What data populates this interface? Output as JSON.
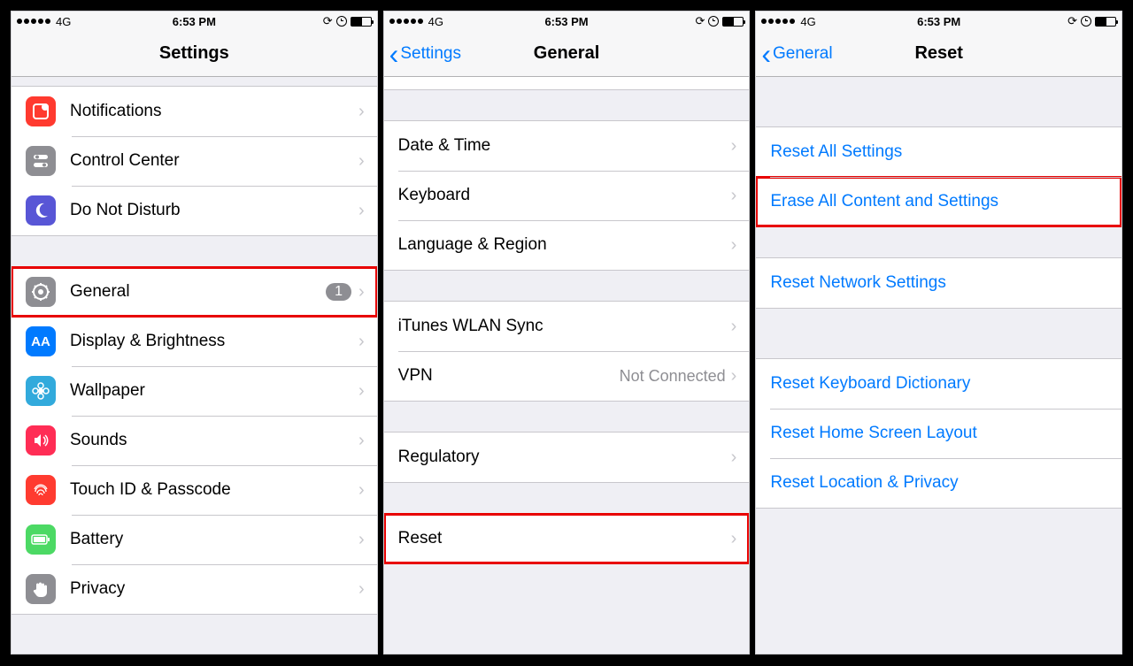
{
  "status": {
    "network": "4G",
    "time": "6:53 PM"
  },
  "screen1": {
    "title": "Settings",
    "rows": [
      {
        "label": "Notifications",
        "icon": "notification-icon",
        "color": "ic-orange"
      },
      {
        "label": "Control Center",
        "icon": "toggles-icon",
        "color": "ic-grey"
      },
      {
        "label": "Do Not Disturb",
        "icon": "moon-icon",
        "color": "ic-purple"
      },
      {
        "label": "General",
        "icon": "gear-icon",
        "color": "ic-grey",
        "badge": "1",
        "highlight": true
      },
      {
        "label": "Display & Brightness",
        "icon": "aa-icon",
        "color": "ic-blue"
      },
      {
        "label": "Wallpaper",
        "icon": "flower-icon",
        "color": "ic-cyan"
      },
      {
        "label": "Sounds",
        "icon": "speaker-icon",
        "color": "ic-pink"
      },
      {
        "label": "Touch ID & Passcode",
        "icon": "fingerprint-icon",
        "color": "ic-red"
      },
      {
        "label": "Battery",
        "icon": "battery-icon",
        "color": "ic-green"
      },
      {
        "label": "Privacy",
        "icon": "hand-icon",
        "color": "ic-grey"
      }
    ]
  },
  "screen2": {
    "back": "Settings",
    "title": "General",
    "groups": [
      [
        {
          "label": "Date & Time"
        },
        {
          "label": "Keyboard"
        },
        {
          "label": "Language & Region"
        }
      ],
      [
        {
          "label": "iTunes WLAN Sync"
        },
        {
          "label": "VPN",
          "detail": "Not Connected"
        }
      ],
      [
        {
          "label": "Regulatory"
        }
      ],
      [
        {
          "label": "Reset",
          "highlight": true
        }
      ]
    ]
  },
  "screen3": {
    "back": "General",
    "title": "Reset",
    "groups": [
      [
        "Reset All Settings",
        "Erase All Content and Settings"
      ],
      [
        "Reset Network Settings"
      ],
      [
        "Reset Keyboard Dictionary",
        "Reset Home Screen Layout",
        "Reset Location & Privacy"
      ]
    ],
    "highlight": "Erase All Content and Settings"
  }
}
